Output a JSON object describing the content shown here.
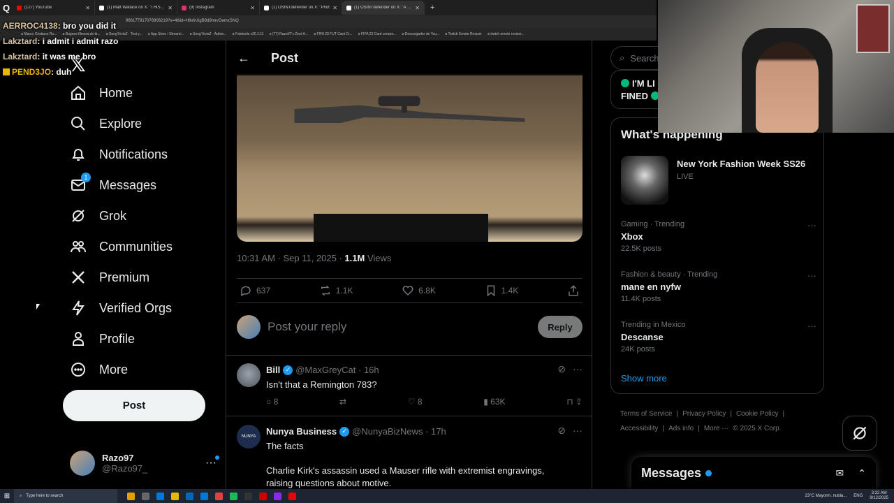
{
  "browser": {
    "tabs": [
      {
        "label": "(127) YouTube",
        "color": "#ff0000"
      },
      {
        "label": "(1) Matt Wallace on X: \"THIS IS",
        "color": "#ffffff"
      },
      {
        "label": "(9) Instagram",
        "color": "#e1306c"
      },
      {
        "label": "(1) OSINTdefender on X: \"Phot",
        "color": "#ffffff"
      },
      {
        "label": "(1) OSINTdefender on X: \"A pic",
        "color": "#ffffff"
      }
    ],
    "url": "966177917076906219?s=46&t=H8vfnXgB8d9mrvOemxSNQ",
    "bookmarks": [
      "Marco Cristiano Ro...",
      "Bugees filmora de tir...",
      "SongTrivia2 - Test y...",
      "App Store / Streami...",
      "SongTrivia2 - Adivin...",
      "Faletools v25.1.11",
      "(77) Razo97's Zest-A...",
      "FIFA 23 FUT Card Cr...",
      "FIFA 23 Card creator...",
      "Descargador de You...",
      "Twitch Emote Resizer",
      "twitch emote resizer..."
    ]
  },
  "chat": [
    {
      "name": "AERROC4138",
      "msg": ": bro you did it",
      "badge": false
    },
    {
      "name": "Lakztard",
      "msg": ": i admit i admit razo",
      "badge": false
    },
    {
      "name": "Lakztard",
      "msg": ": it was me bro",
      "badge": false
    },
    {
      "name": "PEND3JO",
      "msg": ": duh",
      "badge": true
    }
  ],
  "sidebar": {
    "logo": "𝕏",
    "items": [
      {
        "label": "Home",
        "icon": "home-icon"
      },
      {
        "label": "Explore",
        "icon": "search-icon"
      },
      {
        "label": "Notifications",
        "icon": "bell-icon"
      },
      {
        "label": "Messages",
        "icon": "mail-icon",
        "badge": "1"
      },
      {
        "label": "Grok",
        "icon": "grok-icon"
      },
      {
        "label": "Communities",
        "icon": "communities-icon"
      },
      {
        "label": "Premium",
        "icon": "x-icon"
      },
      {
        "label": "Verified Orgs",
        "icon": "lightning-icon"
      },
      {
        "label": "Profile",
        "icon": "person-icon"
      },
      {
        "label": "More",
        "icon": "more-circle-icon"
      }
    ],
    "post_button": "Post",
    "account": {
      "name": "Razo97",
      "handle": "@Razo97_"
    }
  },
  "main": {
    "title": "Post",
    "post": {
      "time": "10:31 AM · Sep 11, 2025 · ",
      "views_count": "1.1M",
      "views_label": " Views",
      "replies": "637",
      "reposts": "1.1K",
      "likes": "6.8K",
      "bookmarks": "1.4K"
    },
    "reply_placeholder": "Post your reply",
    "reply_button": "Reply",
    "replies": [
      {
        "name": "Bill",
        "handle": "@MaxGreyCat · 16h",
        "text": "Isn't that a Remington 783?",
        "comments": "8",
        "reposts": "",
        "likes": "8",
        "views": "63K"
      },
      {
        "name": "Nunya Business",
        "handle": "@NunyaBizNews · 17h",
        "text": "The facts",
        "text2": "Charlie Kirk's assassin used a Mauser rifle with extremist engravings,",
        "text3": "raising questions about motive."
      }
    ]
  },
  "right": {
    "search_placeholder": "Search",
    "live_line1": "I'M LI",
    "live_line2": "FINED",
    "happening_title": "What's happening",
    "featured": {
      "title": "New York Fashion Week SS26",
      "sub": "LIVE"
    },
    "trends": [
      {
        "category": "Gaming · Trending",
        "name": "Xbox",
        "count": "22.5K posts"
      },
      {
        "category": "Fashion & beauty · Trending",
        "name": "mane en nyfw",
        "count": "11.4K posts"
      },
      {
        "category": "Trending in Mexico",
        "name": "Descanse",
        "count": "24K posts"
      }
    ],
    "show_more": "Show more",
    "footer": [
      "Terms of Service",
      "|",
      "Privacy Policy",
      "|",
      "Cookie Policy",
      "|",
      "Accessibility",
      "|",
      "Ads info",
      "|",
      "More ···",
      "© 2025 X Corp."
    ],
    "messages_dock": "Messages"
  },
  "taskbar": {
    "search": "Type here to search",
    "weather": "23°C  Mayorm. nubla...",
    "lang": "ENG",
    "time": "3:32 AM",
    "date": "9/12/2025"
  },
  "colors": {
    "accent": "#1d9bf0",
    "border": "#2f3336",
    "muted": "#71767b",
    "text": "#e7e9ea"
  }
}
